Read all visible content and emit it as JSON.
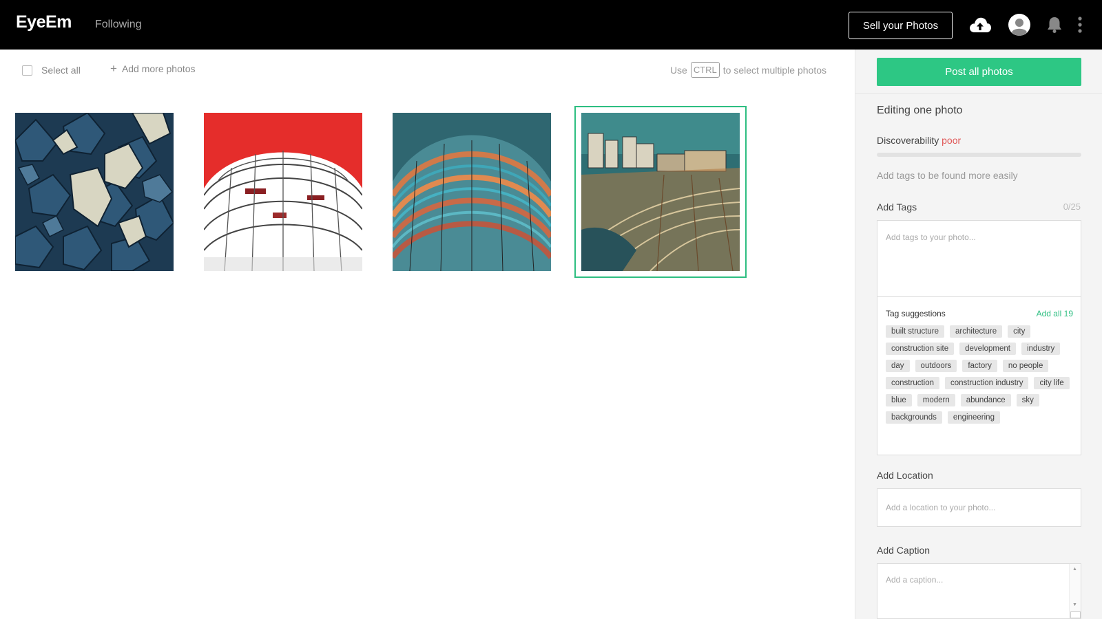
{
  "header": {
    "logo": "EyeEm",
    "nav_following": "Following",
    "sell_label": "Sell your Photos",
    "icons": [
      "upload-icon",
      "avatar-icon",
      "bell-icon",
      "more-vertical-icon"
    ]
  },
  "toolbar": {
    "select_all": "Select all",
    "add_more": "Add more photos",
    "hint_before": "Use",
    "hint_key": "CTRL",
    "hint_after": "to select multiple photos"
  },
  "photos": [
    {
      "subject": "ivy leaves",
      "selected": false
    },
    {
      "subject": "curved building against red sky",
      "selected": false
    },
    {
      "subject": "curved colorful building",
      "selected": false
    },
    {
      "subject": "city construction site",
      "selected": true
    }
  ],
  "panel": {
    "post_all": "Post all photos",
    "editing_title": "Editing one photo",
    "discoverability_label": "Discoverability",
    "discoverability_value": "poor",
    "discoverability_level": 0,
    "discoverability_hint": "Add tags to be found more easily",
    "tags_title": "Add Tags",
    "tags_count": "0/25",
    "tags_placeholder": "Add tags to your photo...",
    "suggestions_title": "Tag suggestions",
    "add_all": "Add all 19",
    "suggestions": [
      "built structure",
      "architecture",
      "city",
      "construction site",
      "development",
      "industry",
      "day",
      "outdoors",
      "factory",
      "no people",
      "construction",
      "construction industry",
      "city life",
      "blue",
      "modern",
      "abundance",
      "sky",
      "backgrounds",
      "engineering"
    ],
    "location_title": "Add Location",
    "location_placeholder": "Add a location to your photo...",
    "caption_title": "Add Caption",
    "caption_placeholder": "Add a caption..."
  },
  "colors": {
    "accent": "#2dc784",
    "poor": "#e05757",
    "header_bg": "#000000"
  }
}
